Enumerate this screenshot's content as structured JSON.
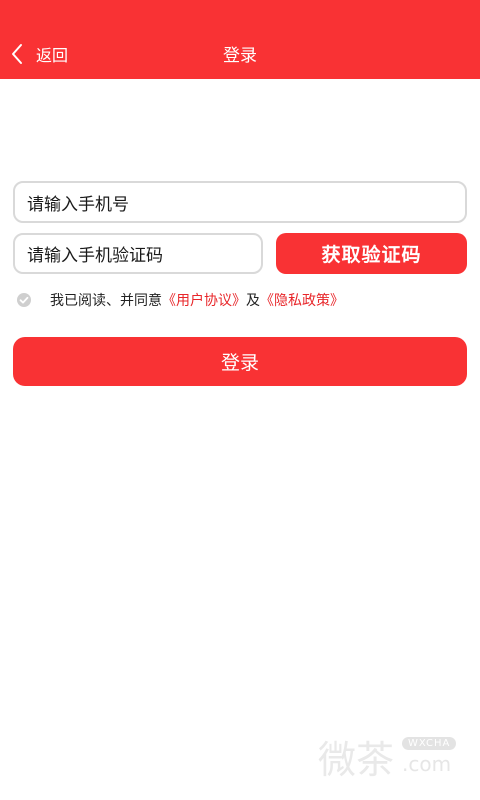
{
  "header": {
    "back_label": "返回",
    "title": "登录"
  },
  "form": {
    "phone_placeholder": "请输入手机号",
    "code_placeholder": "请输入手机验证码",
    "get_code_label": "获取验证码",
    "agreement_prefix": "我已阅读、并同意",
    "agreement_user_link": "《用户协议》",
    "agreement_and": "及",
    "agreement_privacy_link": "《隐私政策》",
    "login_label": "登录"
  },
  "watermark": {
    "text": "微茶",
    "badge": "WXCHA",
    "domain": ".com"
  },
  "colors": {
    "accent": "#f93234",
    "link": "#e8262a",
    "field_border": "#d9d9d9"
  },
  "icons": [
    "chevron-left-icon",
    "checkbox-check-icon"
  ]
}
